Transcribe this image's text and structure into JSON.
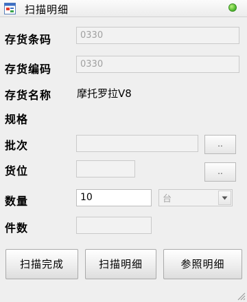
{
  "window": {
    "title": "扫描明细"
  },
  "form": {
    "sku_label": "存货条码",
    "sku_value": "0330",
    "code_label": "存货编码",
    "code_value": "0330",
    "name_label": "存货名称",
    "name_value": "摩托罗拉V8",
    "spec_label": "规格",
    "batch_label": "批次",
    "batch_value": "",
    "batch_button": "..",
    "location_label": "货位",
    "location_value": "",
    "location_button": "..",
    "qty_label": "数量",
    "qty_value": "10",
    "unit_value": "台",
    "pieces_label": "件数",
    "pieces_value": ""
  },
  "buttons": {
    "scan_done": "扫描完成",
    "scan_detail": "扫描明细",
    "ref_detail": "参照明细"
  },
  "colors": {
    "status": "#47b52a"
  }
}
